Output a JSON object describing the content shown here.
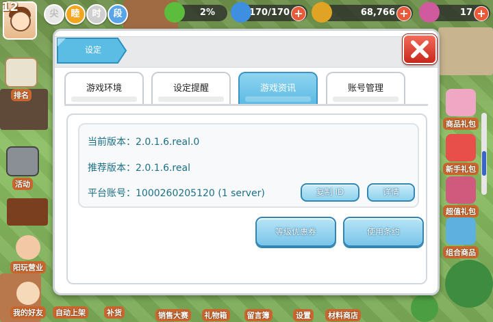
{
  "hud": {
    "level": "12",
    "rank_badges": [
      "尖",
      "睦",
      "时",
      "段"
    ],
    "exp_percent": "2%",
    "energy": "170/170",
    "coins": "68,766",
    "gems": "17"
  },
  "side_menu_left": [
    {
      "label": "排名",
      "icon": "clipboard-icon"
    },
    {
      "label": "活动",
      "icon": "calendar-icon"
    },
    {
      "label": "阳玩营业",
      "icon": "girl-icon"
    },
    {
      "label": "我的好友",
      "icon": "friends-icon"
    }
  ],
  "side_menu_right": [
    {
      "label": "商品礼包",
      "icon": "gift-icon"
    },
    {
      "label": "新手礼包",
      "icon": "shop-icon"
    },
    {
      "label": "超值礼包",
      "icon": "basket-icon"
    },
    {
      "label": "组合商品",
      "icon": "box-icon"
    }
  ],
  "bottom_bar": [
    "自动上架",
    "补货",
    "销售大赛",
    "礼物箱",
    "留言簿",
    "设置",
    "材料商店"
  ],
  "dialog": {
    "title": "设定",
    "tabs": [
      {
        "label": "游戏环境",
        "active": false
      },
      {
        "label": "设定提醒",
        "active": false
      },
      {
        "label": "游戏资讯",
        "active": true
      },
      {
        "label": "账号管理",
        "active": false
      }
    ],
    "info": {
      "current_version": "当前版本：2.0.1.6.real.0",
      "recommended_version": "推荐版本：2.0.1.6.real",
      "platform_account": "平台账号：1000260205120 (1 server)"
    },
    "buttons": {
      "copy_id": "复制 ID",
      "details": "详情",
      "coupon": "等级优惠券",
      "terms": "使用条约"
    }
  },
  "colors": {
    "accent": "#5cbbe4",
    "info_text": "#1b6f86",
    "close": "#d83a2b",
    "tab_active": "#73c6ea"
  }
}
